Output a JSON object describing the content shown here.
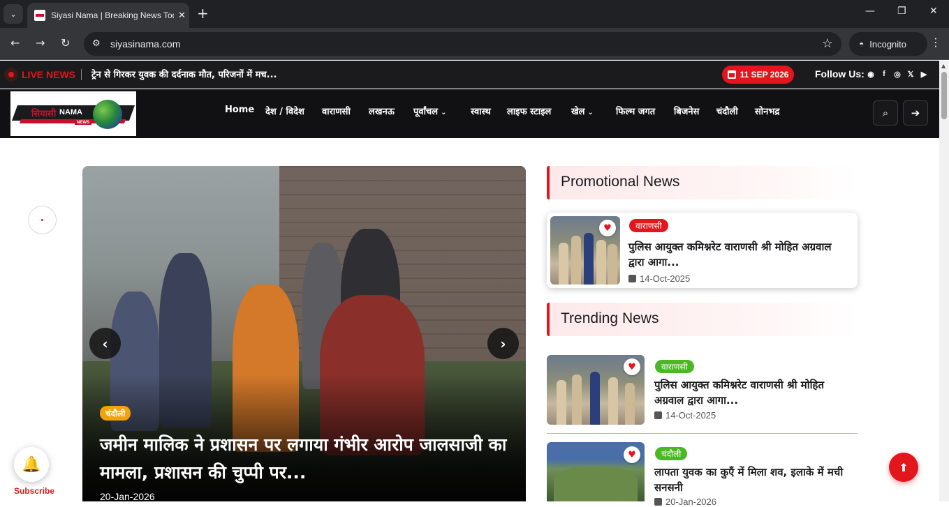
{
  "browser": {
    "tab_title": "Siyasi Nama | Breaking News Today",
    "url": "siyasinama.com",
    "incognito_label": "Incognito",
    "icons": [
      "tab-search-icon",
      "close-icon",
      "plus-icon",
      "back-icon",
      "forward-icon",
      "reload-icon",
      "site-info-icon",
      "star-icon",
      "incognito-icon",
      "kebab-icon",
      "minimize-icon",
      "maximize-icon",
      "window-close-icon"
    ]
  },
  "topbar": {
    "live_label": "LIVE NEWS",
    "ticker_text": "ट्रेन से गिरकर युवक की दर्दनाक मौत, परिजनों में मच...",
    "date": "11 SEP 2026",
    "follow_label": "Follow Us:",
    "social_icons": [
      "whatsapp-icon",
      "facebook-icon",
      "instagram-icon",
      "x-icon",
      "youtube-icon"
    ]
  },
  "logo": {
    "line1": "सियासी",
    "line2": "NAMA",
    "tag": "NEWS"
  },
  "nav": {
    "items": [
      "Home",
      "देश / विदेश",
      "वाराणसी",
      "लखनऊ",
      "पूर्वांचल",
      "स्वास्थ",
      "लाइफ स्टाइल",
      "खेल",
      "फिल्म जगत",
      "बिजनेस",
      "चंदौली",
      "सोनभद्र"
    ]
  },
  "hero": {
    "category": "चंदौली",
    "title": "जमीन मालिक ने प्रशासन पर लगाया गंभीर आरोप जालसाजी का मामला, प्रशासन की चुप्पी पर...",
    "date": "20-Jan-2026"
  },
  "promotional": {
    "heading": "Promotional News",
    "items": [
      {
        "category": "वाराणसी",
        "title": "पुलिस आयुक्त कमिश्नरेट वाराणसी श्री मोहित अग्रवाल द्वारा आगा...",
        "date": "14-Oct-2025"
      }
    ]
  },
  "trending": {
    "heading": "Trending News",
    "items": [
      {
        "category": "वाराणसी",
        "title": "पुलिस आयुक्त कमिश्नरेट वाराणसी श्री मोहित अग्रवाल द्वारा आगा...",
        "date": "14-Oct-2025"
      },
      {
        "category": "चंदौली",
        "title": "लापता युवक का कुएँ में मिला शव, इलाके में मची सनसनी",
        "date": "20-Jan-2026"
      }
    ]
  },
  "floating": {
    "subscribe_label": "Subscribe"
  },
  "colors": {
    "accent": "#e3161d",
    "green_badge": "#4cb821",
    "orange_badge": "#f2a20c",
    "header_bg": "#111113"
  }
}
